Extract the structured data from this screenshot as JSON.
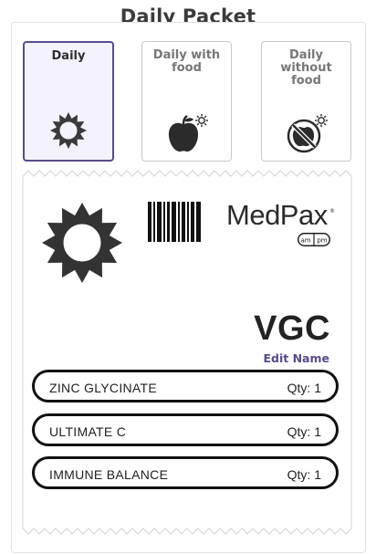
{
  "header": {
    "title": "Daily Packet"
  },
  "options": [
    {
      "label": "Daily",
      "icon": "sun-icon",
      "selected": true
    },
    {
      "label": "Daily with food",
      "icon": "apple-sun-icon",
      "selected": false
    },
    {
      "label": "Daily without food",
      "icon": "no-food-sun-icon",
      "selected": false
    }
  ],
  "packet": {
    "brand": "MedPax",
    "brand_mark": "®",
    "badge": {
      "am": "am",
      "pm": "pm"
    },
    "name": "VGC",
    "edit_label": "Edit Name",
    "items": [
      {
        "name": "ZINC GLYCINATE",
        "qty": "Qty: 1"
      },
      {
        "name": "ULTIMATE C",
        "qty": "Qty: 1"
      },
      {
        "name": "IMMUNE BALANCE",
        "qty": "Qty: 1"
      }
    ]
  },
  "colors": {
    "accent": "#5a4a8c",
    "selected_bg": "#f3f2fd",
    "icon": "#3a3a3a"
  }
}
